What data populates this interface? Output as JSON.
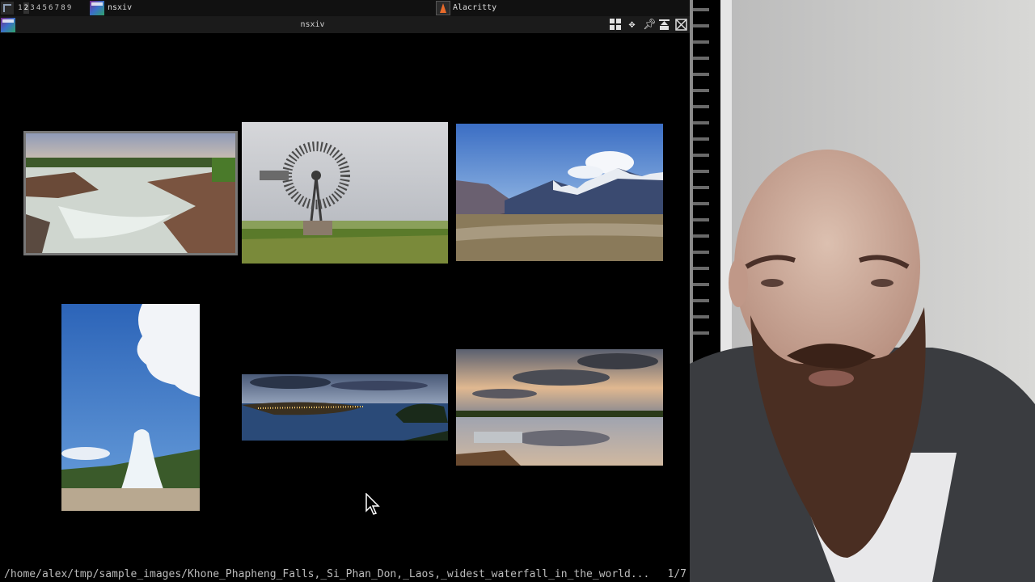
{
  "topbar": {
    "workspaces": [
      "1",
      "2",
      "3",
      "4",
      "5",
      "6",
      "7",
      "8",
      "9"
    ],
    "active_workspace": "2",
    "tasks": [
      {
        "label": "nsxiv",
        "icon": "nsxiv-icon"
      },
      {
        "label": "Alacritty",
        "icon": "alacritty-icon"
      }
    ]
  },
  "window": {
    "title": "nsxiv",
    "buttons": [
      "tile-layout-icon",
      "move-icon",
      "pin-icon",
      "maximize-icon",
      "fullscreen-icon"
    ]
  },
  "thumbnails": [
    {
      "name": "waterfall",
      "selected": true
    },
    {
      "name": "windmill",
      "selected": false
    },
    {
      "name": "mountains",
      "selected": false
    },
    {
      "name": "geyser",
      "selected": false
    },
    {
      "name": "coastal-town-night",
      "selected": false
    },
    {
      "name": "lake-sunset",
      "selected": false
    }
  ],
  "status": {
    "path": "/home/alex/tmp/sample_images/Khone_Phapheng_Falls,_Si_Phan_Don,_Laos,_widest_waterfall_in_the_world...",
    "count": "1/7"
  },
  "colors": {
    "background": "#000000",
    "bar": "#111111",
    "status_text": "#bcbcbc",
    "selection_border": "#777777"
  }
}
